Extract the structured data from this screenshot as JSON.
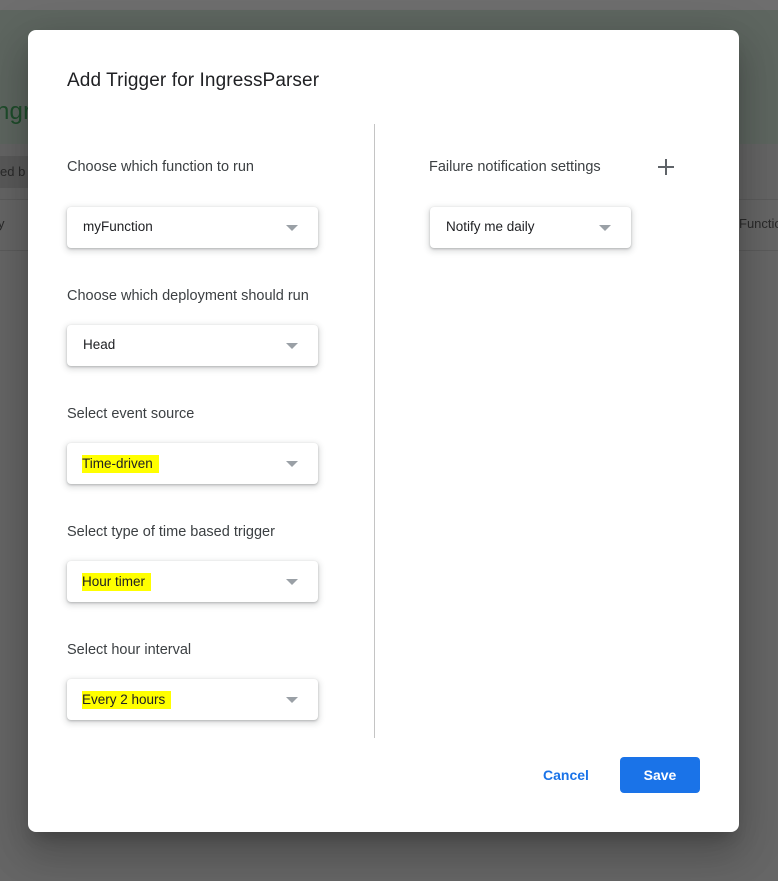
{
  "background": {
    "header_title_fragment": "ngr",
    "toolbar_chip_fragment": "ed b",
    "table_left_fragment": "y",
    "table_right_fragment": "Functio"
  },
  "dialog": {
    "title": "Add Trigger for IngressParser",
    "left_fields": [
      {
        "label": "Choose which function to run",
        "value": "myFunction",
        "highlighted": false
      },
      {
        "label": "Choose which deployment should run",
        "value": "Head",
        "highlighted": false
      },
      {
        "label": "Select event source",
        "value": "Time-driven",
        "highlighted": true
      },
      {
        "label": "Select type of time based trigger",
        "value": "Hour timer",
        "highlighted": true
      },
      {
        "label": "Select hour interval",
        "value": "Every 2 hours",
        "highlighted": true
      }
    ],
    "failure_notification": {
      "label": "Failure notification settings",
      "value": "Notify me daily",
      "add_icon": "plus-icon"
    },
    "buttons": {
      "cancel": "Cancel",
      "save": "Save"
    }
  },
  "colors": {
    "accent": "#1a73e8",
    "highlight": "#ffff00",
    "overlay": "#666666"
  }
}
